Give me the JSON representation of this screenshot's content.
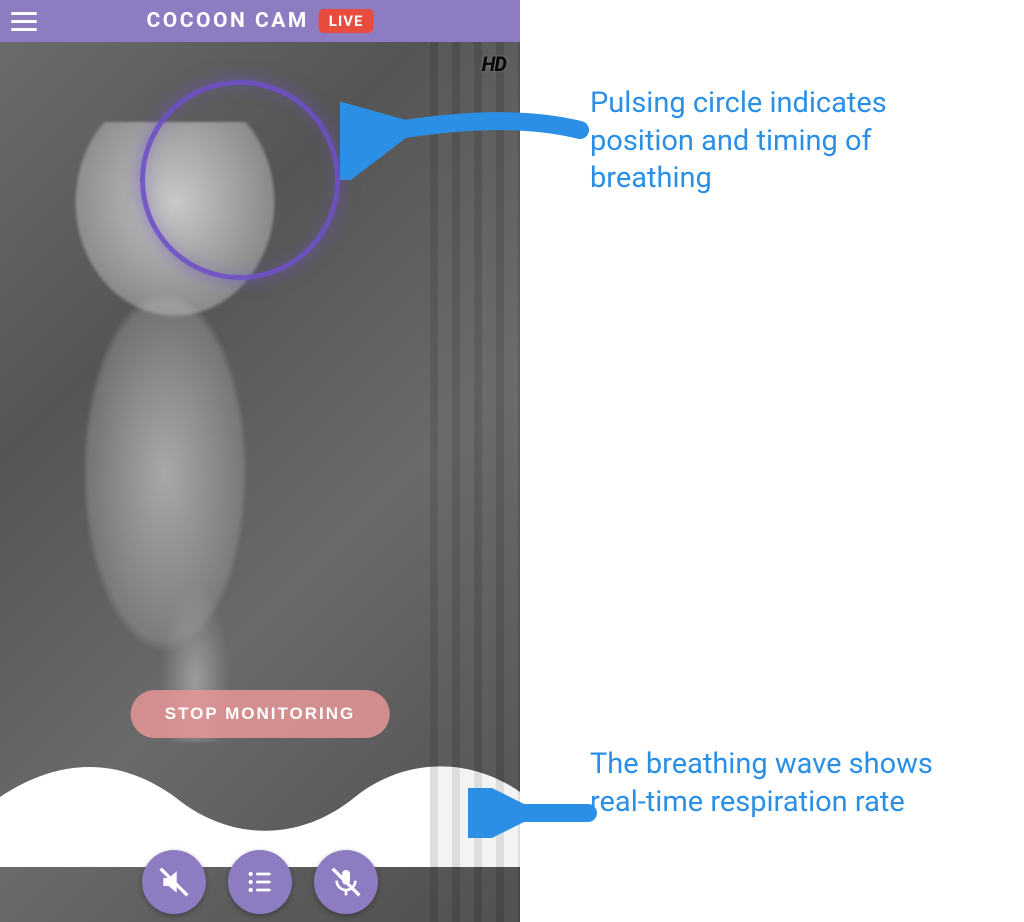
{
  "header": {
    "brand": "COCOON CAM",
    "live_label": "LIVE"
  },
  "video": {
    "hd_label": "HD",
    "stop_label": "STOP MONITORING"
  },
  "controls": {
    "mute_icon": "speaker-muted",
    "menu_icon": "list",
    "mic_icon": "mic-muted"
  },
  "annotations": {
    "circle": "Pulsing circle indicates position and timing of breathing",
    "wave": "The breathing wave shows real-time respiration rate"
  },
  "colors": {
    "accent_purple": "#8e7cc3",
    "live_red": "#e74c3c",
    "arrow_blue": "#2b8fe6",
    "stop_pink": "#e69696"
  }
}
